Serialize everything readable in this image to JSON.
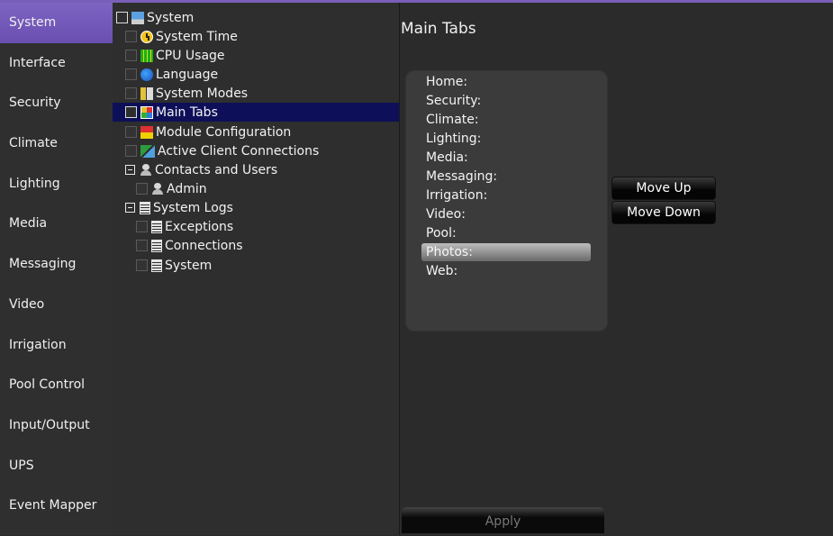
{
  "nav": {
    "items": [
      {
        "label": "System",
        "active": true
      },
      {
        "label": "Interface"
      },
      {
        "label": "Security"
      },
      {
        "label": "Climate"
      },
      {
        "label": "Lighting"
      },
      {
        "label": "Media"
      },
      {
        "label": "Messaging"
      },
      {
        "label": "Video"
      },
      {
        "label": "Irrigation"
      },
      {
        "label": "Pool Control"
      },
      {
        "label": "Input/Output"
      },
      {
        "label": "UPS"
      },
      {
        "label": "Event Mapper"
      }
    ]
  },
  "tree": {
    "root": {
      "label": "System",
      "icon": "computer-icon"
    },
    "system_items": [
      {
        "label": "System Time",
        "icon": "clock-icon"
      },
      {
        "label": "CPU Usage",
        "icon": "cpu-chart-icon"
      },
      {
        "label": "Language",
        "icon": "globe-icon"
      },
      {
        "label": "System Modes",
        "icon": "modes-icon"
      },
      {
        "label": "Main Tabs",
        "icon": "tabs-icon",
        "selected": true
      },
      {
        "label": "Module Configuration",
        "icon": "module-icon"
      },
      {
        "label": "Active Client Connections",
        "icon": "network-icon"
      }
    ],
    "contacts": {
      "label": "Contacts and Users",
      "icon": "users-icon",
      "children": [
        {
          "label": "Admin",
          "icon": "user-icon"
        }
      ]
    },
    "logs": {
      "label": "System Logs",
      "icon": "log-icon",
      "children": [
        {
          "label": "Exceptions",
          "icon": "log-icon"
        },
        {
          "label": "Connections",
          "icon": "log-icon"
        },
        {
          "label": "System",
          "icon": "log-icon"
        }
      ]
    }
  },
  "main": {
    "title": "Main Tabs",
    "tabs": [
      "Home:",
      "Security:",
      "Climate:",
      "Lighting:",
      "Media:",
      "Messaging:",
      "Irrigation:",
      "Video:",
      "Pool:",
      "Photos:",
      "Web:"
    ],
    "selected_index": 9,
    "move_up_label": "Move Up",
    "move_down_label": "Move Down",
    "apply_label": "Apply"
  },
  "colors": {
    "accent": "#7b61c0",
    "selection": "#0d1058"
  }
}
